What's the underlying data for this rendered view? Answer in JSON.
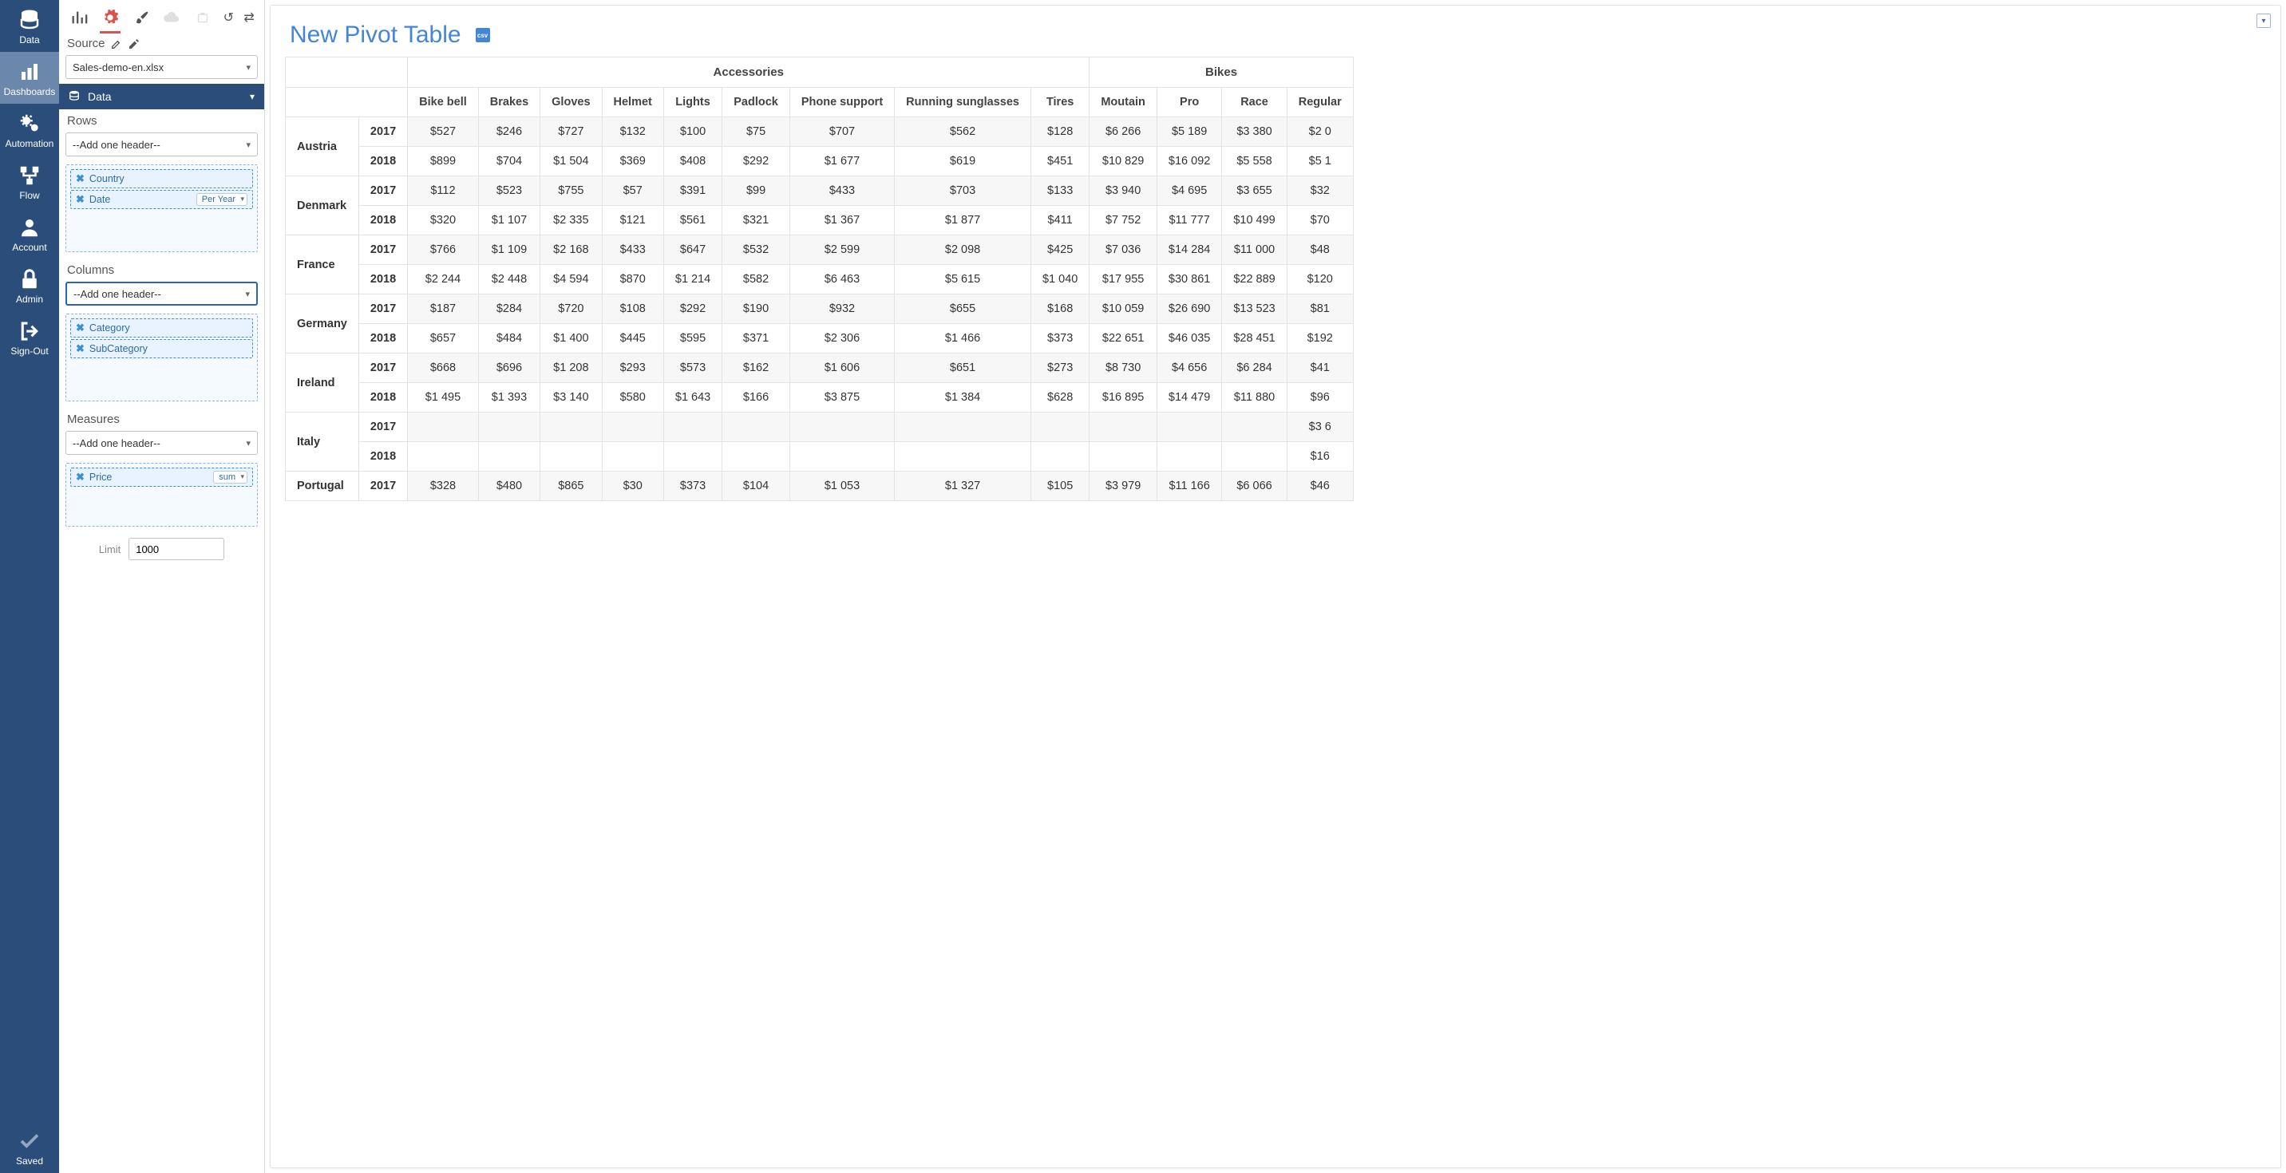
{
  "nav": {
    "data": "Data",
    "dashboards": "Dashboards",
    "automation": "Automation",
    "flow": "Flow",
    "account": "Account",
    "admin": "Admin",
    "signout": "Sign-Out",
    "saved": "Saved"
  },
  "config": {
    "source_label": "Source",
    "source_value": "Sales-demo-en.xlsx",
    "data_section": "Data",
    "rows_label": "Rows",
    "columns_label": "Columns",
    "measures_label": "Measures",
    "add_header_placeholder": "--Add one header--",
    "chip_country": "Country",
    "chip_date": "Date",
    "date_granularity": "Per Year",
    "chip_category": "Category",
    "chip_subcategory": "SubCategory",
    "chip_price": "Price",
    "price_agg": "sum",
    "limit_label": "Limit",
    "limit_value": "1000"
  },
  "main": {
    "title": "New Pivot Table",
    "csv_label": "csv"
  },
  "pivot": {
    "col_groups": [
      "Accessories",
      "Bikes"
    ],
    "columns_acc": [
      "Bike bell",
      "Brakes",
      "Gloves",
      "Helmet",
      "Lights",
      "Padlock",
      "Phone support",
      "Running sunglasses",
      "Tires"
    ],
    "columns_bikes": [
      "Moutain",
      "Pro",
      "Race",
      "Regular"
    ],
    "rows": [
      {
        "country": "Austria",
        "year": "2017",
        "cells": [
          "$527",
          "$246",
          "$727",
          "$132",
          "$100",
          "$75",
          "$707",
          "$562",
          "$128",
          "$6 266",
          "$5 189",
          "$3 380",
          "$2 0"
        ]
      },
      {
        "country": "",
        "year": "2018",
        "cells": [
          "$899",
          "$704",
          "$1 504",
          "$369",
          "$408",
          "$292",
          "$1 677",
          "$619",
          "$451",
          "$10 829",
          "$16 092",
          "$5 558",
          "$5 1"
        ]
      },
      {
        "country": "Denmark",
        "year": "2017",
        "cells": [
          "$112",
          "$523",
          "$755",
          "$57",
          "$391",
          "$99",
          "$433",
          "$703",
          "$133",
          "$3 940",
          "$4 695",
          "$3 655",
          "$32"
        ]
      },
      {
        "country": "",
        "year": "2018",
        "cells": [
          "$320",
          "$1 107",
          "$2 335",
          "$121",
          "$561",
          "$321",
          "$1 367",
          "$1 877",
          "$411",
          "$7 752",
          "$11 777",
          "$10 499",
          "$70"
        ]
      },
      {
        "country": "France",
        "year": "2017",
        "cells": [
          "$766",
          "$1 109",
          "$2 168",
          "$433",
          "$647",
          "$532",
          "$2 599",
          "$2 098",
          "$425",
          "$7 036",
          "$14 284",
          "$11 000",
          "$48"
        ]
      },
      {
        "country": "",
        "year": "2018",
        "cells": [
          "$2 244",
          "$2 448",
          "$4 594",
          "$870",
          "$1 214",
          "$582",
          "$6 463",
          "$5 615",
          "$1 040",
          "$17 955",
          "$30 861",
          "$22 889",
          "$120"
        ]
      },
      {
        "country": "Germany",
        "year": "2017",
        "cells": [
          "$187",
          "$284",
          "$720",
          "$108",
          "$292",
          "$190",
          "$932",
          "$655",
          "$168",
          "$10 059",
          "$26 690",
          "$13 523",
          "$81"
        ]
      },
      {
        "country": "",
        "year": "2018",
        "cells": [
          "$657",
          "$484",
          "$1 400",
          "$445",
          "$595",
          "$371",
          "$2 306",
          "$1 466",
          "$373",
          "$22 651",
          "$46 035",
          "$28 451",
          "$192"
        ]
      },
      {
        "country": "Ireland",
        "year": "2017",
        "cells": [
          "$668",
          "$696",
          "$1 208",
          "$293",
          "$573",
          "$162",
          "$1 606",
          "$651",
          "$273",
          "$8 730",
          "$4 656",
          "$6 284",
          "$41"
        ]
      },
      {
        "country": "",
        "year": "2018",
        "cells": [
          "$1 495",
          "$1 393",
          "$3 140",
          "$580",
          "$1 643",
          "$166",
          "$3 875",
          "$1 384",
          "$628",
          "$16 895",
          "$14 479",
          "$11 880",
          "$96"
        ]
      },
      {
        "country": "Italy",
        "year": "2017",
        "cells": [
          "",
          "",
          "",
          "",
          "",
          "",
          "",
          "",
          "",
          "",
          "",
          "",
          "$3 6"
        ]
      },
      {
        "country": "",
        "year": "2018",
        "cells": [
          "",
          "",
          "",
          "",
          "",
          "",
          "",
          "",
          "",
          "",
          "",
          "",
          "$16"
        ]
      },
      {
        "country": "Portugal",
        "year": "2017",
        "cells": [
          "$328",
          "$480",
          "$865",
          "$30",
          "$373",
          "$104",
          "$1 053",
          "$1 327",
          "$105",
          "$3 979",
          "$11 166",
          "$6 066",
          "$46"
        ]
      }
    ]
  }
}
